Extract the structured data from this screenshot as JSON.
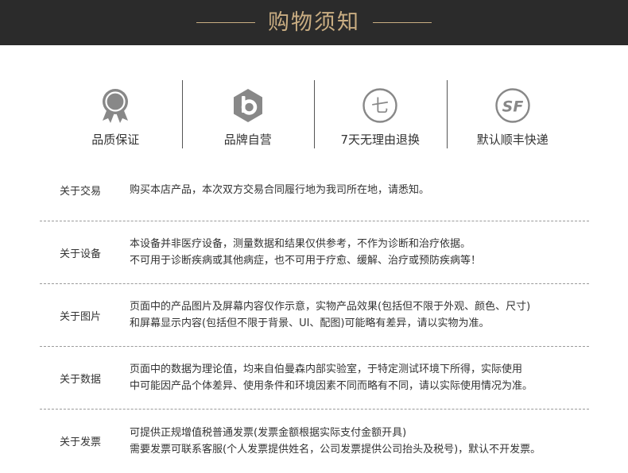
{
  "header": {
    "title": "购物须知"
  },
  "colors": {
    "header_bg": "#2b2b2b",
    "accent_gold": "#c9ad82",
    "icon_gray": "#888888"
  },
  "features": [
    {
      "icon": "award-ribbon-icon",
      "label": "品质保证"
    },
    {
      "icon": "brand-hexagon-icon",
      "label": "品牌自营"
    },
    {
      "icon": "return-circle-icon",
      "icon_text": "七",
      "label": "7天无理由退换"
    },
    {
      "icon": "sf-express-icon",
      "icon_text": "SF",
      "label": "默认顺丰快递"
    }
  ],
  "notices": [
    {
      "key": "关于交易",
      "lines": [
        "购买本店产品，本次双方交易合同履行地为我司所在地，请悉知。"
      ]
    },
    {
      "key": "关于设备",
      "lines": [
        "本设备并非医疗设备，测量数据和结果仅供参考，不作为诊断和治疗依据。",
        "不可用于诊断疾病或其他病症，也不可用于疗愈、缓解、治疗或预防疾病等！"
      ]
    },
    {
      "key": "关于图片",
      "lines": [
        "页面中的产品图片及屏幕内容仅作示意，实物产品效果(包括但不限于外观、颜色、尺寸)",
        "和屏幕显示内容(包括但不限于背景、UI、配图)可能略有差异，请以实物为准。"
      ]
    },
    {
      "key": "关于数据",
      "lines": [
        "页面中的数据为理论值，均来自伯曼森内部实验室，于特定测试环境下所得，实际使用",
        "中可能因产品个体差异、使用条件和环境因素不同而略有不同，请以实际使用情况为准。"
      ]
    },
    {
      "key": "关于发票",
      "lines": [
        "可提供正规增值税普通发票(发票金额根据实际支付金额开具)",
        "需要发票可联系客服(个人发票提供姓名，公司发票提供公司抬头及税号)，默认不开发票。"
      ]
    }
  ]
}
